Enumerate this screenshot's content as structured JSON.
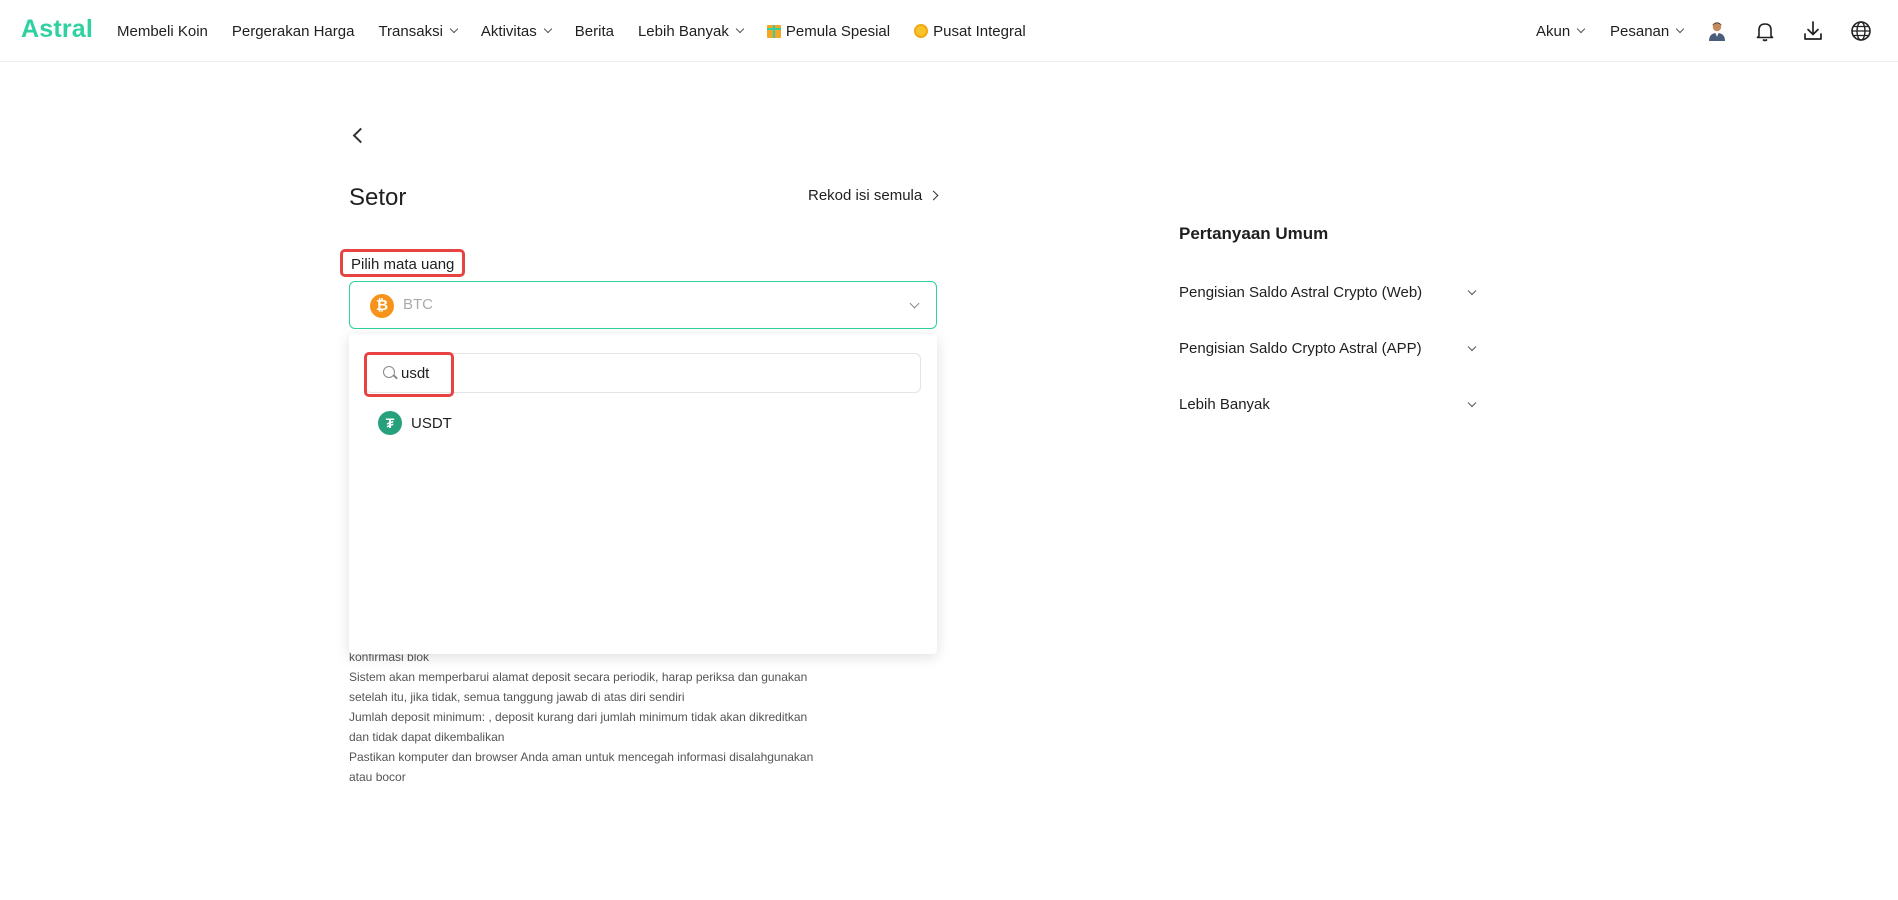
{
  "header": {
    "logo": "Astral",
    "nav": [
      {
        "label": "Membeli Koin"
      },
      {
        "label": "Pergerakan Harga"
      },
      {
        "label": "Transaksi"
      },
      {
        "label": "Aktivitas"
      },
      {
        "label": "Berita"
      },
      {
        "label": "Lebih Banyak"
      },
      {
        "label": "Pemula Spesial"
      },
      {
        "label": "Pusat Integral"
      }
    ],
    "account_label": "Akun",
    "orders_label": "Pesanan"
  },
  "main": {
    "title": "Setor",
    "record_link": "Rekod isi semula",
    "currency_label": "Pilih mata uang",
    "selected_currency": "BTC",
    "search_value": "usdt",
    "results": [
      {
        "symbol": "USDT"
      }
    ],
    "notes": [
      "konfirmasi blok",
      "Sistem akan memperbarui alamat deposit secara periodik, harap periksa dan gunakan",
      "setelah itu, jika tidak, semua tanggung jawab di atas diri sendiri",
      "Jumlah deposit minimum: , deposit kurang dari jumlah minimum tidak akan dikreditkan",
      "dan tidak dapat dikembalikan",
      "Pastikan komputer dan browser Anda aman untuk mencegah informasi disalahgunakan",
      "atau bocor"
    ]
  },
  "faq": {
    "title": "Pertanyaan Umum",
    "items": [
      {
        "label": "Pengisian Saldo Astral Crypto (Web)"
      },
      {
        "label": "Pengisian Saldo Crypto Astral (APP)"
      },
      {
        "label": "Lebih Banyak"
      }
    ]
  },
  "colors": {
    "brand": "#2fd1a0",
    "highlight": "#e84343",
    "btc": "#f7931a",
    "usdt": "#26a17b"
  },
  "icons": [
    "user-avatar-icon",
    "bell-icon",
    "download-icon",
    "globe-icon",
    "search-icon",
    "back-arrow-icon"
  ]
}
